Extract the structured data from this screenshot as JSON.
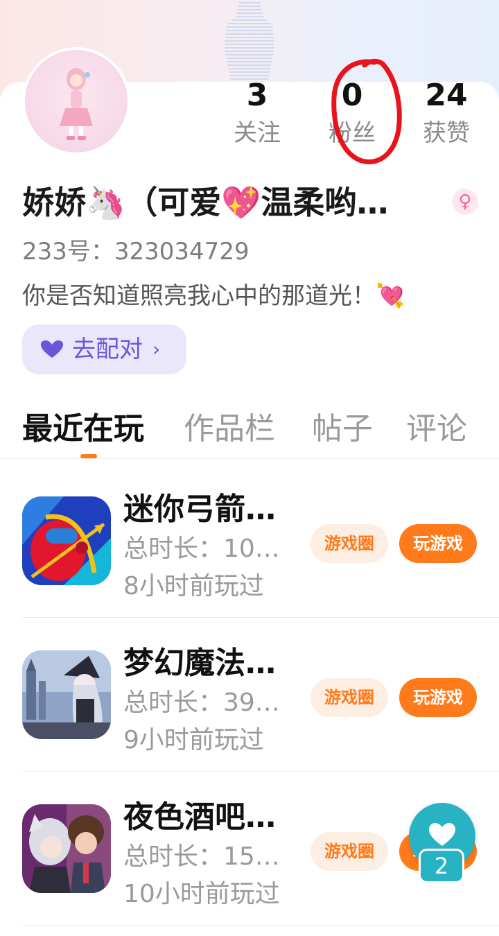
{
  "profile": {
    "stats": [
      {
        "value": "3",
        "label": "关注"
      },
      {
        "value": "0",
        "label": "粉丝"
      },
      {
        "value": "24",
        "label": "获赞"
      }
    ],
    "name": "娇娇🦄（可爱💖温柔哟…",
    "gender_symbol": "♀",
    "uid": "233号：323034729",
    "bio": "你是否知道照亮我心中的那道光！💘",
    "match_button": "去配对"
  },
  "tabs": [
    {
      "label": "最近在玩",
      "active": true
    },
    {
      "label": "作品栏",
      "active": false
    },
    {
      "label": "帖子",
      "active": false
    },
    {
      "label": "评论",
      "active": false
    }
  ],
  "games": [
    {
      "title": "迷你弓箭…",
      "duration": "总时长：10…",
      "last_played": "8小时前玩过",
      "circle_label": "游戏圈",
      "play_label": "玩游戏"
    },
    {
      "title": "梦幻魔法…",
      "duration": "总时长：39…",
      "last_played": "9小时前玩过",
      "circle_label": "游戏圈",
      "play_label": "玩游戏"
    },
    {
      "title": "夜色酒吧…",
      "duration": "总时长：15…",
      "last_played": "10小时前玩过",
      "circle_label": "游戏圈",
      "play_label": "玩游戏"
    }
  ],
  "like_fab": {
    "count": "2"
  },
  "colors": {
    "accent": "#ff7a1a",
    "match": "#6b55d8",
    "fab": "#27b3c4",
    "annotation": "#e8141b"
  }
}
